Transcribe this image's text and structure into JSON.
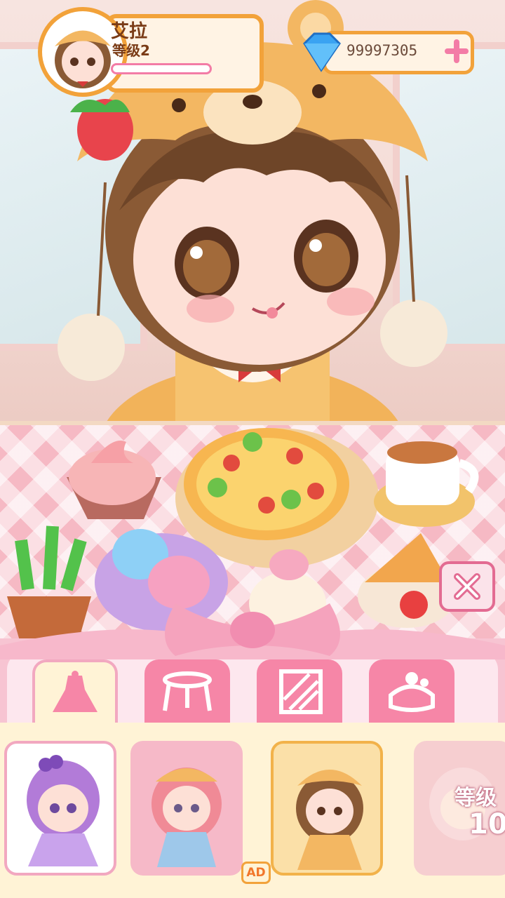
{
  "player": {
    "name": "艾拉",
    "level_label": "等级2",
    "xp_progress": 0.0
  },
  "currency": {
    "gems": "99997305",
    "add_icon": "plus-icon",
    "gem_icon": "diamond-icon"
  },
  "tabs": [
    {
      "icon": "dress-icon",
      "active": true
    },
    {
      "icon": "stool-icon",
      "active": false
    },
    {
      "icon": "wallpaper-icon",
      "active": false
    },
    {
      "icon": "dessert-icon",
      "active": false
    }
  ],
  "characters": [
    {
      "name": "grape-girl",
      "selected": true
    },
    {
      "name": "cherry-cap-girl",
      "selected": false
    },
    {
      "name": "bear-hat-girl",
      "selected": false
    },
    {
      "name": "cat-girl-locked",
      "locked": true,
      "lock_label": "等级",
      "lock_value": "10"
    }
  ],
  "close_icon": "close-icon",
  "ad_label": "AD",
  "colors": {
    "accent_orange": "#f2a23a",
    "accent_pink": "#f686a7",
    "panel_cream": "#fff3d6"
  }
}
